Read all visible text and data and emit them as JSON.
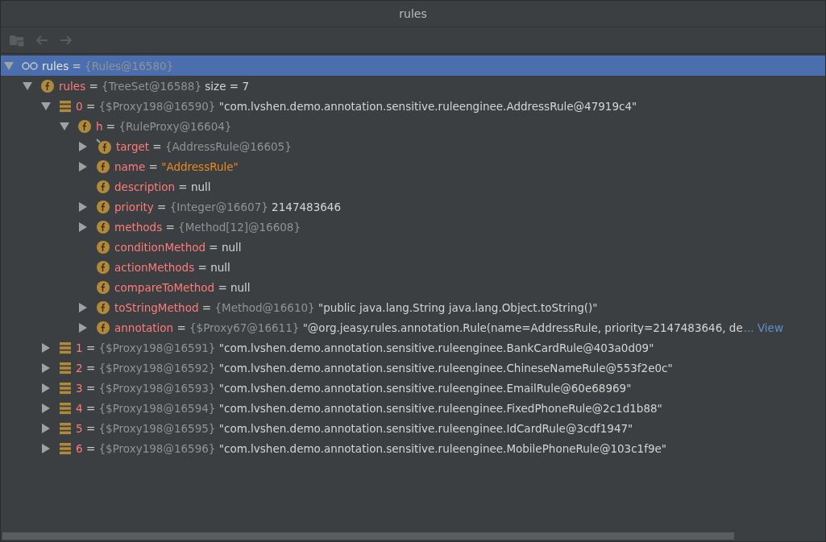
{
  "window": {
    "title": "rules"
  },
  "toolbar": [
    {
      "kind": "folder",
      "disabled": true
    },
    {
      "kind": "back",
      "disabled": true
    },
    {
      "kind": "forward",
      "disabled": true
    }
  ],
  "tree": [
    {
      "kind": "watch",
      "name": "rules",
      "operator": "=",
      "type": "{Rules@16580}",
      "selected": true,
      "expanded": true,
      "children": [
        {
          "kind": "field",
          "name": "rules",
          "operator": "=",
          "type": "{TreeSet@16588}",
          "suffix": "size = 7",
          "selected": false,
          "expanded": true,
          "children": [
            {
              "kind": "element",
              "name": "0",
              "operator": "=",
              "type": "{$Proxy198@16590}",
              "value": "\"com.lvshen.demo.annotation.sensitive.ruleenginee.AddressRule@47919c4\"",
              "selected": false,
              "expanded": true,
              "children": [
                {
                  "kind": "field",
                  "name": "h",
                  "operator": "=",
                  "type": "{RuleProxy@16604}",
                  "selected": false,
                  "expanded": true,
                  "children": [
                    {
                      "kind": "field-marked",
                      "name": "target",
                      "operator": "=",
                      "type": "{AddressRule@16605}",
                      "selected": false,
                      "expanded": false
                    },
                    {
                      "kind": "field",
                      "name": "name",
                      "operator": "=",
                      "string_value": "\"AddressRule\"",
                      "selected": false,
                      "expanded": false
                    },
                    {
                      "kind": "field",
                      "name": "description",
                      "operator": "=",
                      "value": "null",
                      "selected": false
                    },
                    {
                      "kind": "field",
                      "name": "priority",
                      "operator": "=",
                      "type": "{Integer@16607}",
                      "value": "2147483646",
                      "selected": false,
                      "expanded": false
                    },
                    {
                      "kind": "field",
                      "name": "methods",
                      "operator": "=",
                      "type": "{Method[12]@16608}",
                      "selected": false,
                      "expanded": false
                    },
                    {
                      "kind": "field",
                      "name": "conditionMethod",
                      "operator": "=",
                      "value": "null",
                      "selected": false
                    },
                    {
                      "kind": "field",
                      "name": "actionMethods",
                      "operator": "=",
                      "value": "null",
                      "selected": false
                    },
                    {
                      "kind": "field",
                      "name": "compareToMethod",
                      "operator": "=",
                      "value": "null",
                      "selected": false
                    },
                    {
                      "kind": "field",
                      "name": "toStringMethod",
                      "operator": "=",
                      "type": "{Method@16610}",
                      "value": "\"public java.lang.String java.lang.Object.toString()\"",
                      "selected": false,
                      "expanded": false
                    },
                    {
                      "kind": "field",
                      "name": "annotation",
                      "operator": "=",
                      "type": "{$Proxy67@16611}",
                      "value": "\"@org.jeasy.rules.annotation.Rule(name=AddressRule, priority=2147483646, de",
                      "link": "... View",
                      "selected": false,
                      "expanded": false
                    }
                  ]
                }
              ]
            },
            {
              "kind": "element",
              "name": "1",
              "operator": "=",
              "type": "{$Proxy198@16591}",
              "value": "\"com.lvshen.demo.annotation.sensitive.ruleenginee.BankCardRule@403a0d09\"",
              "selected": false,
              "expanded": false
            },
            {
              "kind": "element",
              "name": "2",
              "operator": "=",
              "type": "{$Proxy198@16592}",
              "value": "\"com.lvshen.demo.annotation.sensitive.ruleenginee.ChineseNameRule@553f2e0c\"",
              "selected": false,
              "expanded": false
            },
            {
              "kind": "element",
              "name": "3",
              "operator": "=",
              "type": "{$Proxy198@16593}",
              "value": "\"com.lvshen.demo.annotation.sensitive.ruleenginee.EmailRule@60e68969\"",
              "selected": false,
              "expanded": false
            },
            {
              "kind": "element",
              "name": "4",
              "operator": "=",
              "type": "{$Proxy198@16594}",
              "value": "\"com.lvshen.demo.annotation.sensitive.ruleenginee.FixedPhoneRule@2c1d1b88\"",
              "selected": false,
              "expanded": false
            },
            {
              "kind": "element",
              "name": "5",
              "operator": "=",
              "type": "{$Proxy198@16595}",
              "value": "\"com.lvshen.demo.annotation.sensitive.ruleenginee.IdCardRule@3cdf1947\"",
              "selected": false,
              "expanded": false
            },
            {
              "kind": "element",
              "name": "6",
              "operator": "=",
              "type": "{$Proxy198@16596}",
              "value": "\"com.lvshen.demo.annotation.sensitive.ruleenginee.MobilePhoneRule@103c1f9e\"",
              "selected": false,
              "expanded": false
            }
          ]
        }
      ]
    }
  ]
}
